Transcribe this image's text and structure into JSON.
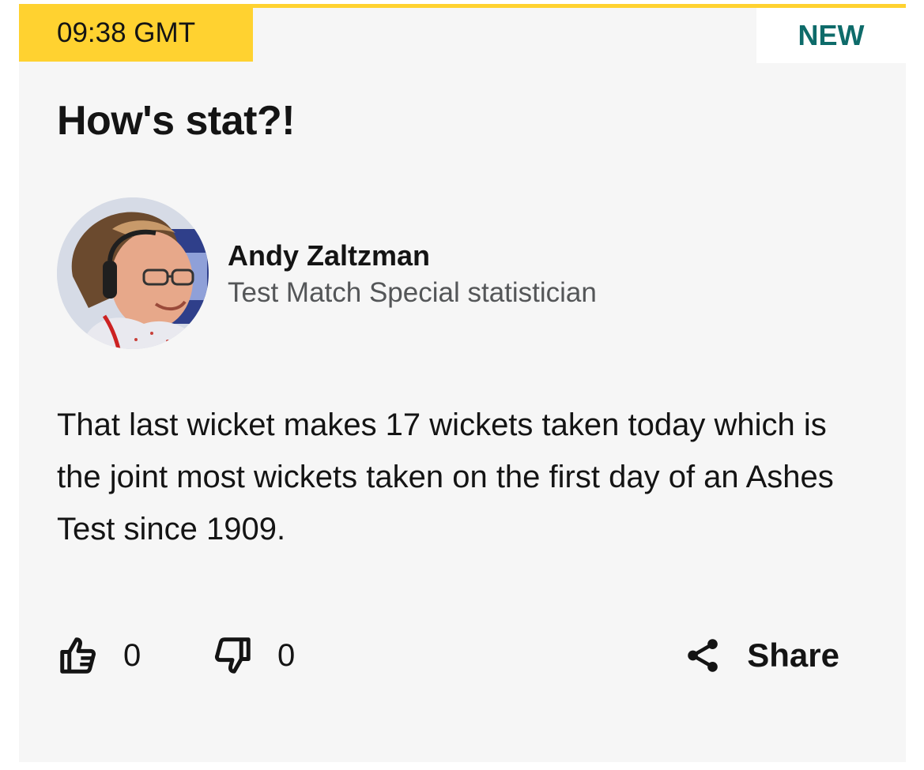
{
  "post": {
    "time": "09:38 GMT",
    "badge": "NEW",
    "title": "How's stat?!",
    "author": {
      "name": "Andy Zaltzman",
      "role": "Test Match Special statistician"
    },
    "body": "That last wicket makes 17 wickets taken today which is the joint most wickets taken on the first day of an Ashes Test since 1909.",
    "reactions": {
      "likes": "0",
      "dislikes": "0"
    },
    "share_label": "Share"
  },
  "colors": {
    "accent": "#ffd230",
    "new_badge_text": "#0e6b6a",
    "card_background": "#f6f6f6",
    "role_text": "#545658"
  },
  "icons": {
    "like": "thumbs-up-icon",
    "dislike": "thumbs-down-icon",
    "share": "share-icon"
  }
}
